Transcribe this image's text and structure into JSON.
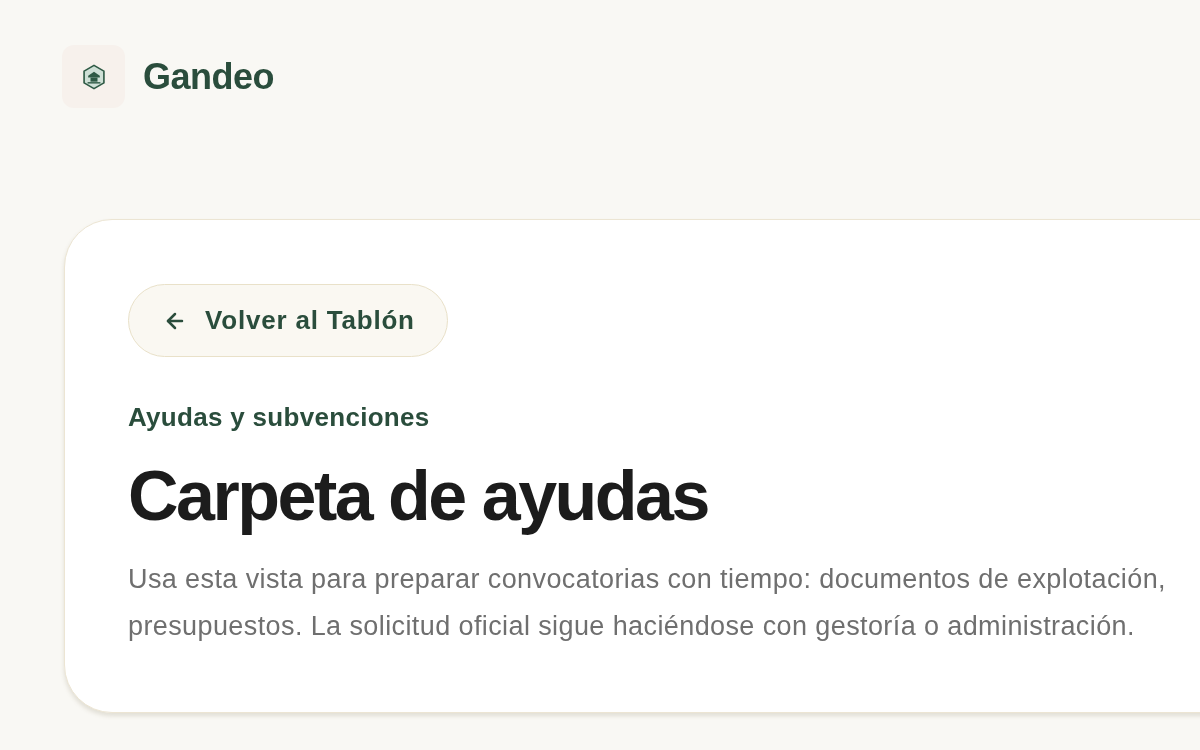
{
  "header": {
    "brand": "Gandeo"
  },
  "card": {
    "back_button": {
      "label": "Volver al Tablón"
    },
    "eyebrow": "Ayudas y subvenciones",
    "title": "Carpeta de ayudas",
    "description_lines": [
      "Usa esta vista para preparar convocatorias con tiempo: documentos de explotación,",
      "presupuestos. La solicitud oficial sigue haciéndose con gestoría o administración."
    ]
  }
}
